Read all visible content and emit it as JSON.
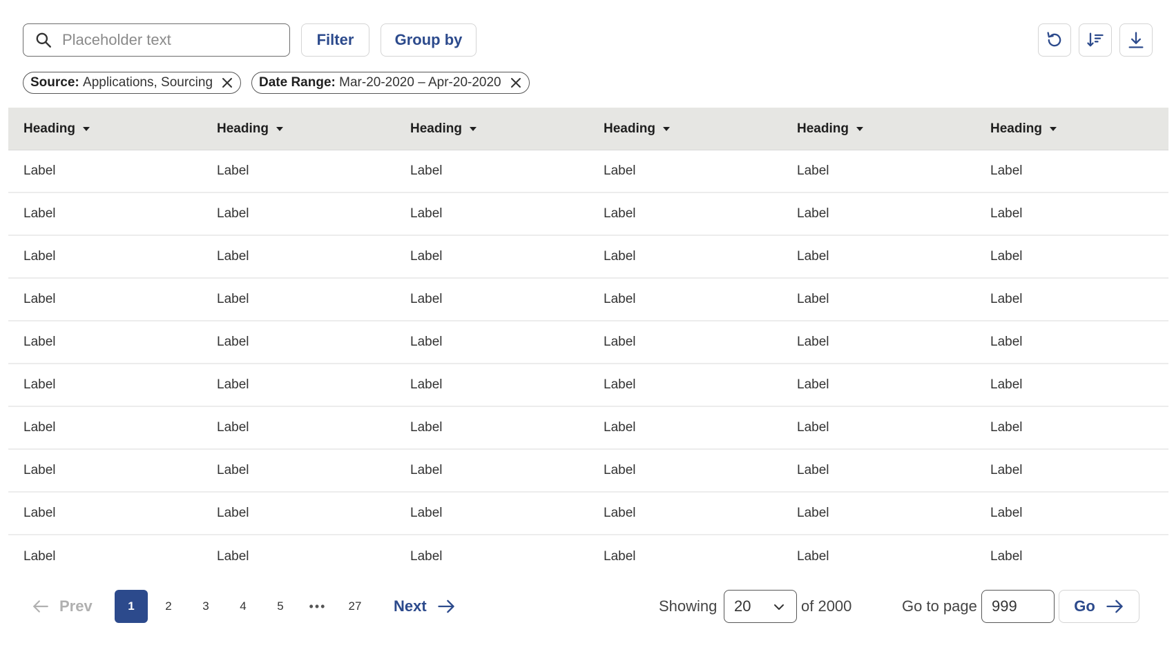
{
  "toolbar": {
    "search_placeholder": "Placeholder text",
    "filter_label": "Filter",
    "group_by_label": "Group by",
    "icons": [
      "search-icon",
      "refresh-icon",
      "sort-icon",
      "download-icon"
    ]
  },
  "chips": [
    {
      "key": "Source:",
      "value": "Applications, Sourcing"
    },
    {
      "key": "Date Range:",
      "value": "Mar-20-2020 – Apr-20-2020"
    }
  ],
  "table": {
    "headers": [
      "Heading",
      "Heading",
      "Heading",
      "Heading",
      "Heading",
      "Heading"
    ],
    "rows": [
      [
        "Label",
        "Label",
        "Label",
        "Label",
        "Label",
        "Label"
      ],
      [
        "Label",
        "Label",
        "Label",
        "Label",
        "Label",
        "Label"
      ],
      [
        "Label",
        "Label",
        "Label",
        "Label",
        "Label",
        "Label"
      ],
      [
        "Label",
        "Label",
        "Label",
        "Label",
        "Label",
        "Label"
      ],
      [
        "Label",
        "Label",
        "Label",
        "Label",
        "Label",
        "Label"
      ],
      [
        "Label",
        "Label",
        "Label",
        "Label",
        "Label",
        "Label"
      ],
      [
        "Label",
        "Label",
        "Label",
        "Label",
        "Label",
        "Label"
      ],
      [
        "Label",
        "Label",
        "Label",
        "Label",
        "Label",
        "Label"
      ],
      [
        "Label",
        "Label",
        "Label",
        "Label",
        "Label",
        "Label"
      ],
      [
        "Label",
        "Label",
        "Label",
        "Label",
        "Label",
        "Label"
      ]
    ]
  },
  "pagination": {
    "prev_label": "Prev",
    "next_label": "Next",
    "pages": [
      "1",
      "2",
      "3",
      "4",
      "5"
    ],
    "ellipsis": "•••",
    "last_page": "27",
    "current_page": "1",
    "showing_label": "Showing",
    "per_page": "20",
    "of_total": "of 2000",
    "goto_label": "Go to page",
    "goto_value": "999",
    "go_label": "Go"
  },
  "colors": {
    "accent": "#2c4a8c",
    "header_bg": "#e6e6e3",
    "disabled": "#b0b0b0"
  }
}
